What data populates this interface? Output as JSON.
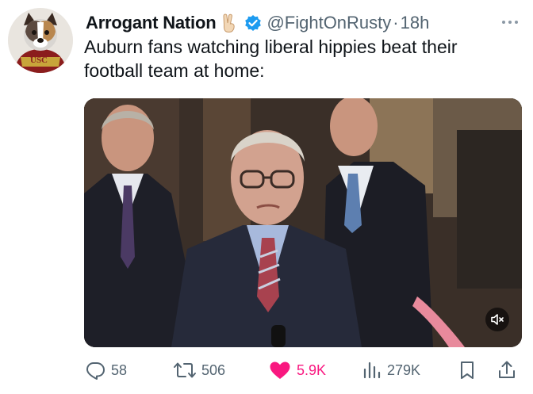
{
  "tweet": {
    "author": {
      "display_name": "Arrogant Nation",
      "emoji_icon": "victory-hand-icon",
      "verified": true,
      "handle": "@FightOnRusty",
      "time": "18h",
      "avatar_badge": "USC"
    },
    "separator": "·",
    "text_line1": "Auburn fans watching liberal hippies beat their",
    "text_line2": "football team at home:",
    "media": {
      "type": "video",
      "muted": true
    },
    "stats": {
      "replies": "58",
      "reposts": "506",
      "likes": "5.9K",
      "views": "279K"
    },
    "colors": {
      "like_active": "#f91880",
      "verified_blue": "#1d9bf0",
      "muted_text": "#536471"
    }
  }
}
